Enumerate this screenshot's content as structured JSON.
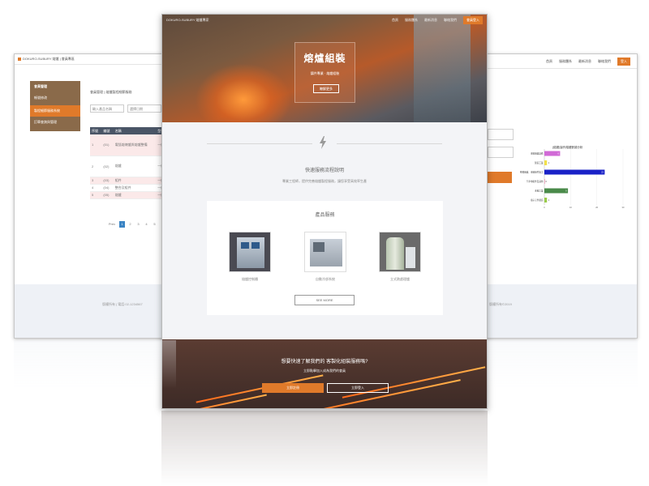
{
  "left_window": {
    "brand": "DOKURO-SUBURY 熔爐 | 會員專區",
    "sidebar": [
      "會員管理",
      "帳號修改",
      "製程細節服務系統",
      "訂單查詢與管理"
    ],
    "breadcrumb": "會員管理 ) 熔爐製程細節服務",
    "filter_placeholder_1": "輸入產品名稱",
    "filter_placeholder_2": "選擇日期",
    "filter_button": "搜尋",
    "table_headers": [
      "序號",
      "編號",
      "名稱",
      "型號",
      "狀態"
    ],
    "rows": [
      [
        "1",
        "(01)",
        "電弧熔煉爐與熔爐整備",
        "一般",
        "審核"
      ],
      [
        "2",
        "(02)",
        "熔爐",
        "一般",
        "審核"
      ],
      [
        "3",
        "(03)",
        "組件",
        "一般",
        ""
      ],
      [
        "4",
        "(04)",
        "整合及組件",
        "一般",
        ""
      ],
      [
        "5",
        "(05)",
        "熔爐",
        "一般",
        ""
      ]
    ],
    "pager": [
      "Prev",
      "1",
      "2",
      "3",
      "4",
      "5"
    ],
    "footer": "版權所有 | 電話:02-1234567"
  },
  "right_window": {
    "nav": [
      "首頁",
      "服務體系",
      "最新消息",
      "聯絡我們"
    ],
    "login": "登入",
    "footer": "版權所有©2019"
  },
  "chart_data": {
    "type": "bar",
    "title": "(熔爐)製作熔爐數據分析",
    "orientation": "horizontal",
    "categories": [
      "金屬熔爐設備",
      "製造工業",
      "整體熔爐、金屬組件加工",
      "汽車零組件及其他",
      "金屬工業",
      "電子元件製造"
    ],
    "values": [
      6,
      1,
      23,
      0,
      9,
      1
    ],
    "colors": [
      "#d16ad6",
      "#f2e04a",
      "#1a22c7",
      "#e87aa0",
      "#4a8a4a",
      "#9acb4a"
    ],
    "xlim": [
      0,
      30
    ],
    "ticks": [
      0,
      10,
      20,
      30
    ]
  },
  "main": {
    "brand": "DOKURO-SUBURY 熔爐專家",
    "nav": [
      "首頁",
      "服務體系",
      "最新消息",
      "聯絡我們"
    ],
    "login": "會員登入",
    "hero_title": "熔爐組裝",
    "hero_subtitle": "鑄件專業 · 熔爐組裝",
    "hero_button": "瞭解更多",
    "section_title": "快速服務流程說明",
    "section_desc": "專業工程師，提供完善熔爐製程服務，讓您享受高效率生產",
    "products_title": "產品服務",
    "products": [
      {
        "caption": "熔爐控制櫃"
      },
      {
        "caption": "自動冷卻系統"
      },
      {
        "caption": "立式熱處理爐"
      }
    ],
    "see_more": "SEE MORE",
    "cta_title": "想要快速了解我們的 客製化組裝服務嗎?",
    "cta_sub": "立即點擊加入成為我們的會員",
    "cta_btn_primary": "立即註冊",
    "cta_btn_secondary": "立即登入"
  }
}
